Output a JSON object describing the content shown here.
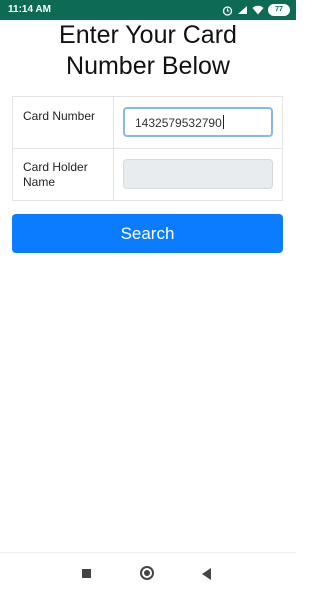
{
  "status_bar": {
    "time": "11:14 AM",
    "battery": "77",
    "icons": [
      "alarm-icon",
      "signal-icon",
      "wifi-icon",
      "battery-icon"
    ]
  },
  "page": {
    "heading_line1": "Enter Your Card",
    "heading_line2": "Number Below"
  },
  "form": {
    "card_number_label": "Card Number",
    "card_number_value": "1432579532790",
    "card_holder_label": "Card Holder Name",
    "card_holder_value": ""
  },
  "search_button": {
    "label": "Search"
  },
  "nav_bar": {
    "buttons": [
      "recents",
      "home",
      "back"
    ]
  },
  "colors": {
    "status_bar": "#0d6b53",
    "primary_button": "#0a7cff",
    "focus_border": "#88b7f0",
    "disabled_field": "#e9ecef"
  }
}
